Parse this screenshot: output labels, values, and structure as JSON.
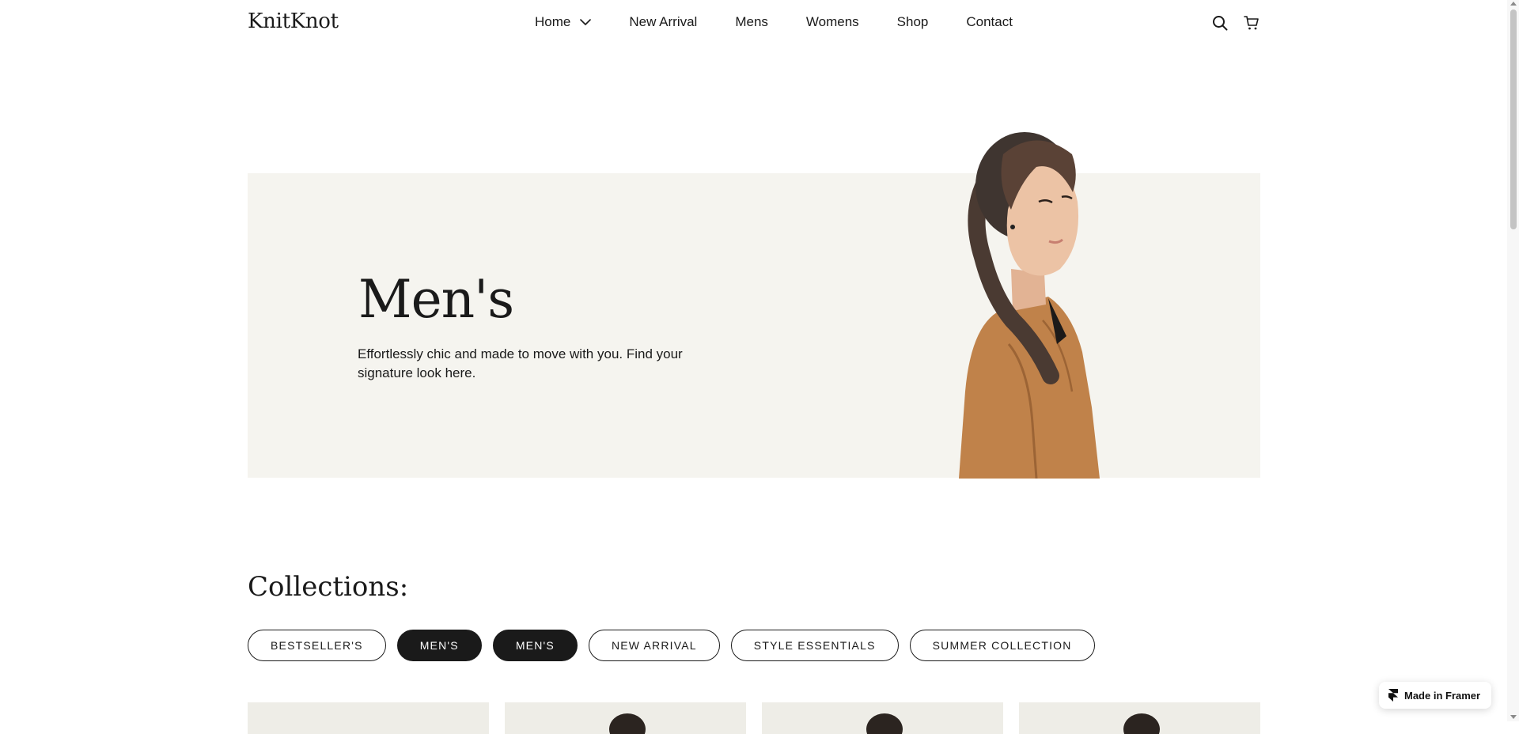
{
  "brand": {
    "logo_text": "KnitKnot"
  },
  "nav": {
    "items": [
      {
        "label": "Home",
        "has_dropdown": true
      },
      {
        "label": "New Arrival"
      },
      {
        "label": "Mens"
      },
      {
        "label": "Womens"
      },
      {
        "label": "Shop"
      },
      {
        "label": "Contact"
      }
    ]
  },
  "header_icons": {
    "search": "search-icon",
    "cart": "cart-icon"
  },
  "hero": {
    "title": "Men's",
    "description": "Effortlessly chic and made to move with you. Find your signature look here.",
    "image": "model-in-orange-jacket"
  },
  "collections": {
    "title": "Collections:",
    "chips": [
      {
        "label": "BESTSELLER'S",
        "active": false
      },
      {
        "label": "MEN'S",
        "active": true
      },
      {
        "label": "MEN'S",
        "active": true
      },
      {
        "label": "NEW ARRIVAL",
        "active": false
      },
      {
        "label": "STYLE ESSENTIALS",
        "active": false
      },
      {
        "label": "SUMMER COLLECTION",
        "active": false
      }
    ]
  },
  "badge": {
    "label": "Made in Framer",
    "icon": "framer-icon"
  },
  "colors": {
    "text": "#1a1a1a",
    "hero_background": "#f5f4ef",
    "chip_active": "#1a1a1a",
    "card_background": "#eeede7",
    "jacket": "#c0824a"
  }
}
